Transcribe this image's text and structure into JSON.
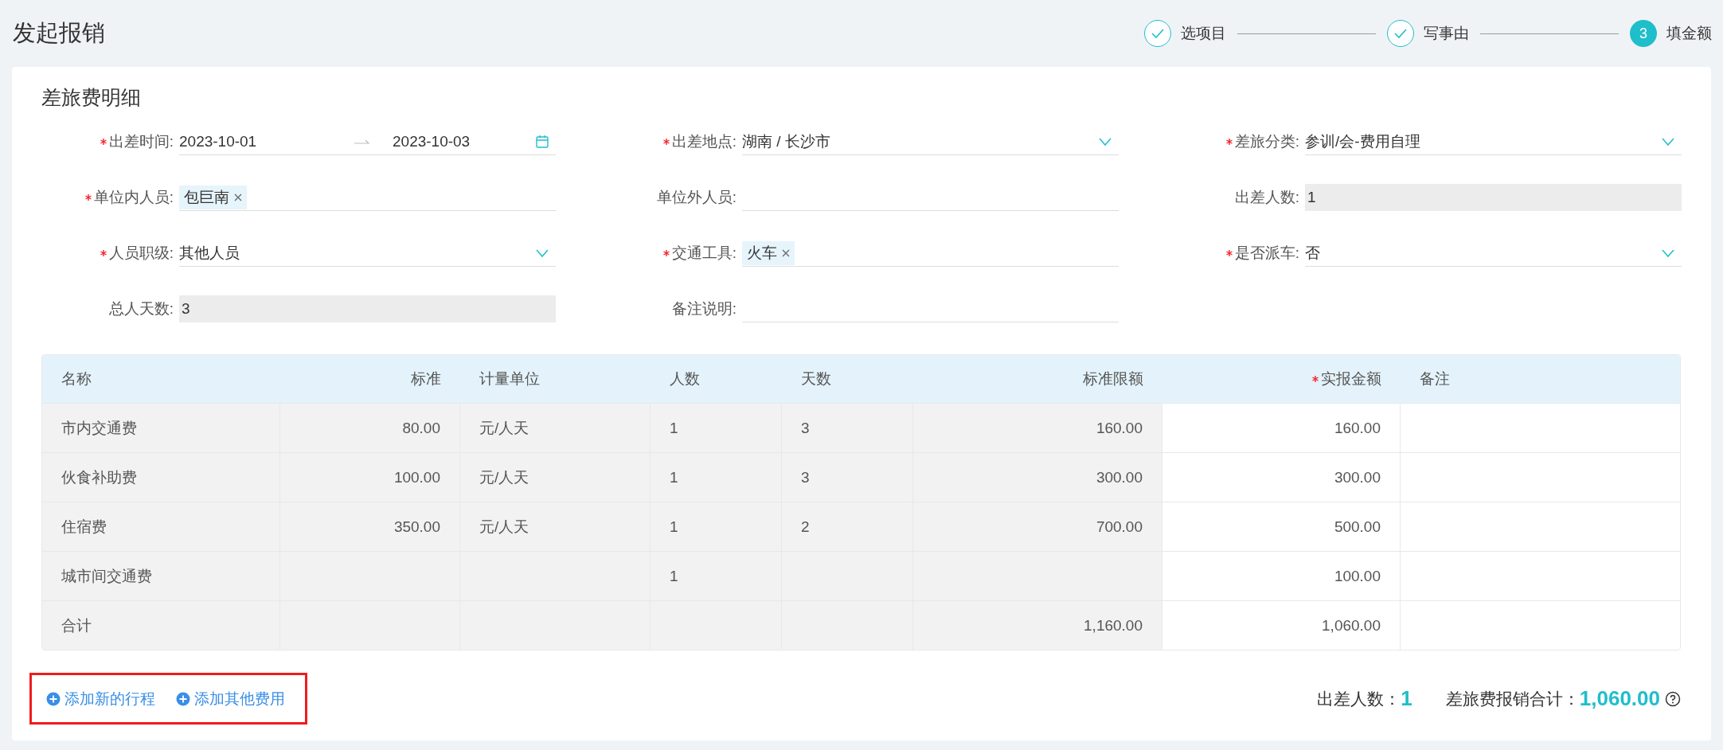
{
  "page": {
    "title": "发起报销"
  },
  "steps": [
    {
      "label": "选项目",
      "kind": "done"
    },
    {
      "label": "写事由",
      "kind": "done"
    },
    {
      "label": "填金额",
      "kind": "current",
      "number": "3"
    }
  ],
  "section": {
    "title": "差旅费明细"
  },
  "form_fields": [
    {
      "label": "出差时间:",
      "required": true,
      "kind": "date-range",
      "start": "2023-10-01",
      "end": "2023-10-03"
    },
    {
      "label": "出差地点:",
      "required": true,
      "kind": "select",
      "value": "湖南 / 长沙市"
    },
    {
      "label": "差旅分类:",
      "required": true,
      "kind": "select",
      "value": "参训/会-费用自理"
    },
    {
      "label": "单位内人员:",
      "required": true,
      "kind": "tags",
      "tags": [
        "包巨南"
      ]
    },
    {
      "label": "单位外人员:",
      "required": false,
      "kind": "text"
    },
    {
      "label": "出差人数:",
      "required": false,
      "kind": "readonly",
      "value": "1"
    },
    {
      "label": "人员职级:",
      "required": true,
      "kind": "select",
      "value": "其他人员"
    },
    {
      "label": "交通工具:",
      "required": true,
      "kind": "tags",
      "tags": [
        "火车"
      ]
    },
    {
      "label": "是否派车:",
      "required": true,
      "kind": "select",
      "value": "否"
    },
    {
      "label": "总人天数:",
      "required": false,
      "kind": "readonly",
      "value": "3"
    },
    {
      "label": "备注说明:",
      "required": false,
      "kind": "text"
    }
  ],
  "table": {
    "columns": [
      {
        "label": "名称",
        "required": false,
        "editable": false
      },
      {
        "label": "标准",
        "required": false,
        "editable": false
      },
      {
        "label": "计量单位",
        "required": false,
        "editable": false
      },
      {
        "label": "人数",
        "required": false,
        "editable": false
      },
      {
        "label": "天数",
        "required": false,
        "editable": false
      },
      {
        "label": "标准限额",
        "required": false,
        "editable": false
      },
      {
        "label": "实报金额",
        "required": true,
        "editable": true
      },
      {
        "label": "备注",
        "required": false,
        "editable": true
      }
    ],
    "rows": [
      {
        "cells": [
          "市内交通费",
          "80.00",
          "元/人天",
          "1",
          "3",
          "160.00",
          "160.00",
          null
        ]
      },
      {
        "cells": [
          "伙食补助费",
          "100.00",
          "元/人天",
          "1",
          "3",
          "300.00",
          "300.00",
          null
        ]
      },
      {
        "cells": [
          "住宿费",
          "350.00",
          "元/人天",
          "1",
          "2",
          "700.00",
          "500.00",
          null
        ]
      },
      {
        "cells": [
          "城市间交通费",
          null,
          null,
          "1",
          null,
          null,
          "100.00",
          null
        ]
      },
      {
        "cells": [
          "合计",
          null,
          null,
          null,
          null,
          "1,160.00",
          "1,060.00",
          null
        ]
      }
    ]
  },
  "actions": [
    {
      "label": "添加新的行程"
    },
    {
      "label": "添加其他费用"
    }
  ],
  "summary": [
    {
      "label": "出差人数：",
      "value": "1",
      "kind": "count"
    },
    {
      "label": "差旅费报销合计：",
      "value": "1,060.00",
      "kind": "total"
    }
  ]
}
